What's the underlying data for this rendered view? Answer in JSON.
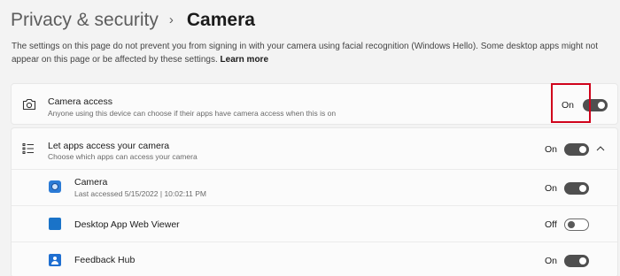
{
  "breadcrumb": {
    "parent": "Privacy & security",
    "separator": "›",
    "current": "Camera"
  },
  "description": {
    "text": "The settings on this page do not prevent you from signing in with your camera using facial recognition (Windows Hello). Some desktop apps might not appear on this page or be affected by these settings.",
    "link": "Learn more"
  },
  "camera_access": {
    "title": "Camera access",
    "subtitle": "Anyone using this device can choose if their apps have camera access when this is on",
    "state": "On",
    "icon": "camera-icon"
  },
  "let_apps": {
    "title": "Let apps access your camera",
    "subtitle": "Choose which apps can access your camera",
    "state": "On",
    "icon": "list-icon"
  },
  "apps": [
    {
      "name": "Camera",
      "subtitle": "Last accessed 5/15/2022  |  10:02:11 PM",
      "state": "On",
      "icon": "camera-app-icon"
    },
    {
      "name": "Desktop App Web Viewer",
      "subtitle": "",
      "state": "Off",
      "icon": "web-viewer-icon"
    },
    {
      "name": "Feedback Hub",
      "subtitle": "",
      "state": "On",
      "icon": "feedback-hub-icon"
    }
  ],
  "colors": {
    "accent": "#0067c0",
    "highlight": "#d0021b",
    "toggle_on": "#4f4f4f"
  }
}
